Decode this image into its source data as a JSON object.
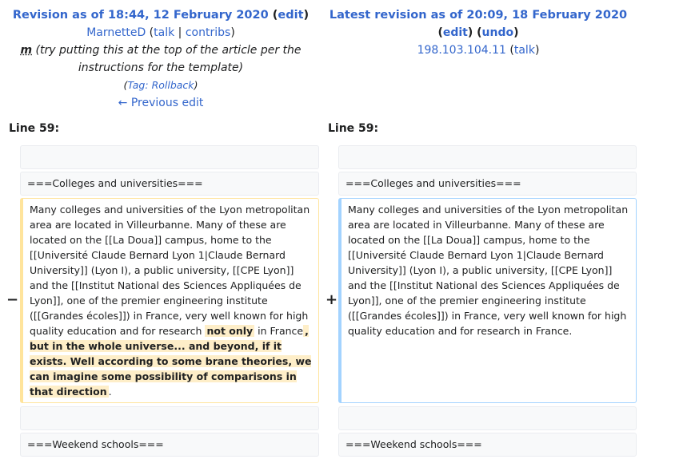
{
  "left": {
    "title_prefix": "Revision as of 18:44, 12 February 2020",
    "edit_link": "edit",
    "user": "MarnetteD",
    "talk_link": "talk",
    "contribs_link": "contribs",
    "minor_mark": "m",
    "summary": "(try putting this at the top of the article per the instructions for the template)",
    "tag_label": "Tag:",
    "tag_value": "Rollback",
    "prev_edit": "← Previous edit",
    "line_label": "Line 59:"
  },
  "right": {
    "title": "Latest revision as of 20:09, 18 February 2020",
    "edit_link": "edit",
    "undo_link": "undo",
    "user": "198.103.104.11",
    "talk_link": "talk",
    "line_label": "Line 59:"
  },
  "diff": {
    "heading1": "===Colleges and universities===",
    "common_text": "Many colleges and universities of the Lyon metropolitan area are located in Villeurbanne. Many of these are located on the [[La Doua]] campus, home to the [[Université Claude Bernard Lyon 1|Claude Bernard University]] (Lyon I), a public university, [[CPE Lyon]] and the [[Institut National des Sciences Appliquées de Lyon]], one of the premier engineering institute ([[Grandes écoles]]) in France, very well known for high quality education and for research",
    "deleted_frag1": "not only",
    "deleted_mid": " in France",
    "deleted_frag2": ", but in the whole universe... and beyond, if it exists. Well according to some brane theories, we can imagine some possibility of comparisons in that direction",
    "deleted_end": ".",
    "added_end": " in France.",
    "heading2": "===Weekend schools===",
    "minus": "−",
    "plus": "+"
  }
}
